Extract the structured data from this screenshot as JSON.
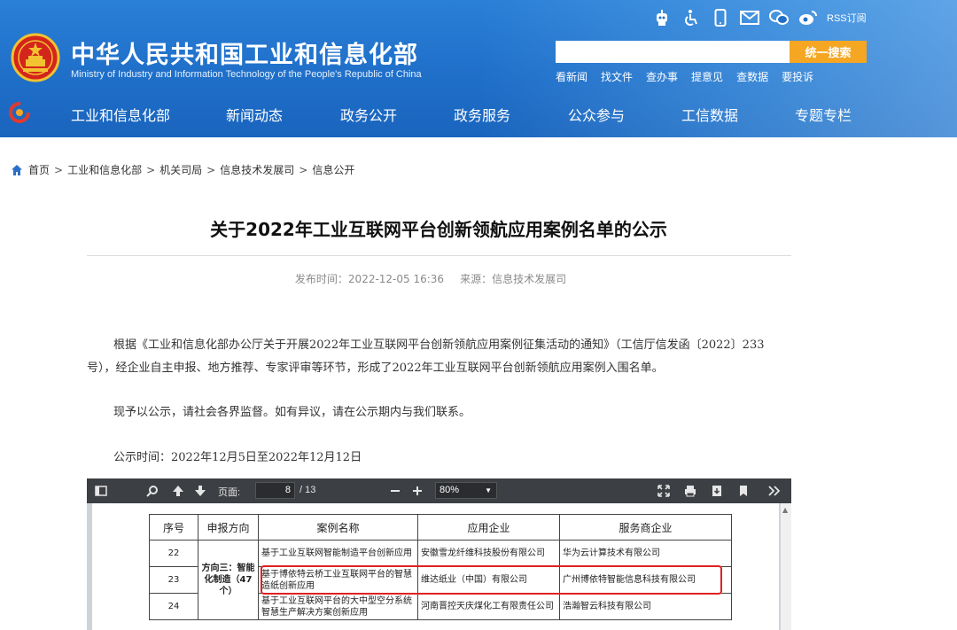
{
  "header": {
    "title": "中华人民共和国工业和信息化部",
    "subtitle": "Ministry of Industry and Information Technology of the People's Republic of China",
    "rss_label": "RSS订阅",
    "search": {
      "placeholder": "",
      "button": "统一搜索"
    },
    "quick_links": [
      "看新闻",
      "找文件",
      "查办事",
      "提意见",
      "查数据",
      "要投诉"
    ]
  },
  "nav": [
    "工业和信息化部",
    "新闻动态",
    "政务公开",
    "政务服务",
    "公众参与",
    "工信数据",
    "专题专栏"
  ],
  "breadcrumb": [
    "首页",
    "工业和信息化部",
    "机关司局",
    "信息技术发展司",
    "信息公开"
  ],
  "article": {
    "title": "关于2022年工业互联网平台创新领航应用案例名单的公示",
    "publish_time": "发布时间：2022-12-05 16:36",
    "source": "来源：信息技术发展司",
    "paragraph1": "根据《工业和信息化部办公厅关于开展2022年工业互联网平台创新领航应用案例征集活动的通知》（工信厅信发函〔2022〕233号），经企业自主申报、地方推荐、专家评审等环节，形成了2022年工业互联网平台创新领航应用案例入围名单。",
    "paragraph2": "现予以公示，请社会各界监督。如有异议，请在公示期内与我们联系。",
    "paragraph3": "公示时间：2022年12月5日至2022年12月12日"
  },
  "pdf_viewer": {
    "page_label": "页面:",
    "current_page": "8",
    "total_pages": "/ 13",
    "zoom": "80%",
    "table": {
      "headers": [
        "序号",
        "申报方向",
        "案例名称",
        "应用企业",
        "服务商企业"
      ],
      "direction": "方向三：智能化制造（47个）",
      "rows": [
        {
          "no": "22",
          "name": "基于工业互联网智能制造平台创新应用",
          "app": "安徽雪龙纤维科技股份有限公司",
          "svc": "华为云计算技术有限公司"
        },
        {
          "no": "23",
          "name": "基于博依特云桥工业互联网平台的智慧造纸创新应用",
          "app": "维达纸业（中国）有限公司",
          "svc": "广州博依特智能信息科技有限公司"
        },
        {
          "no": "24",
          "name": "基于工业互联网平台的大中型空分系统智慧生产解决方案创新应用",
          "app": "河南晋控天庆煤化工有限责任公司",
          "svc": "浩瀚智云科技有限公司"
        }
      ]
    }
  },
  "colors": {
    "header_blue": "#1f6fc9",
    "search_button": "#f5a623",
    "highlight_red": "#e02020"
  }
}
